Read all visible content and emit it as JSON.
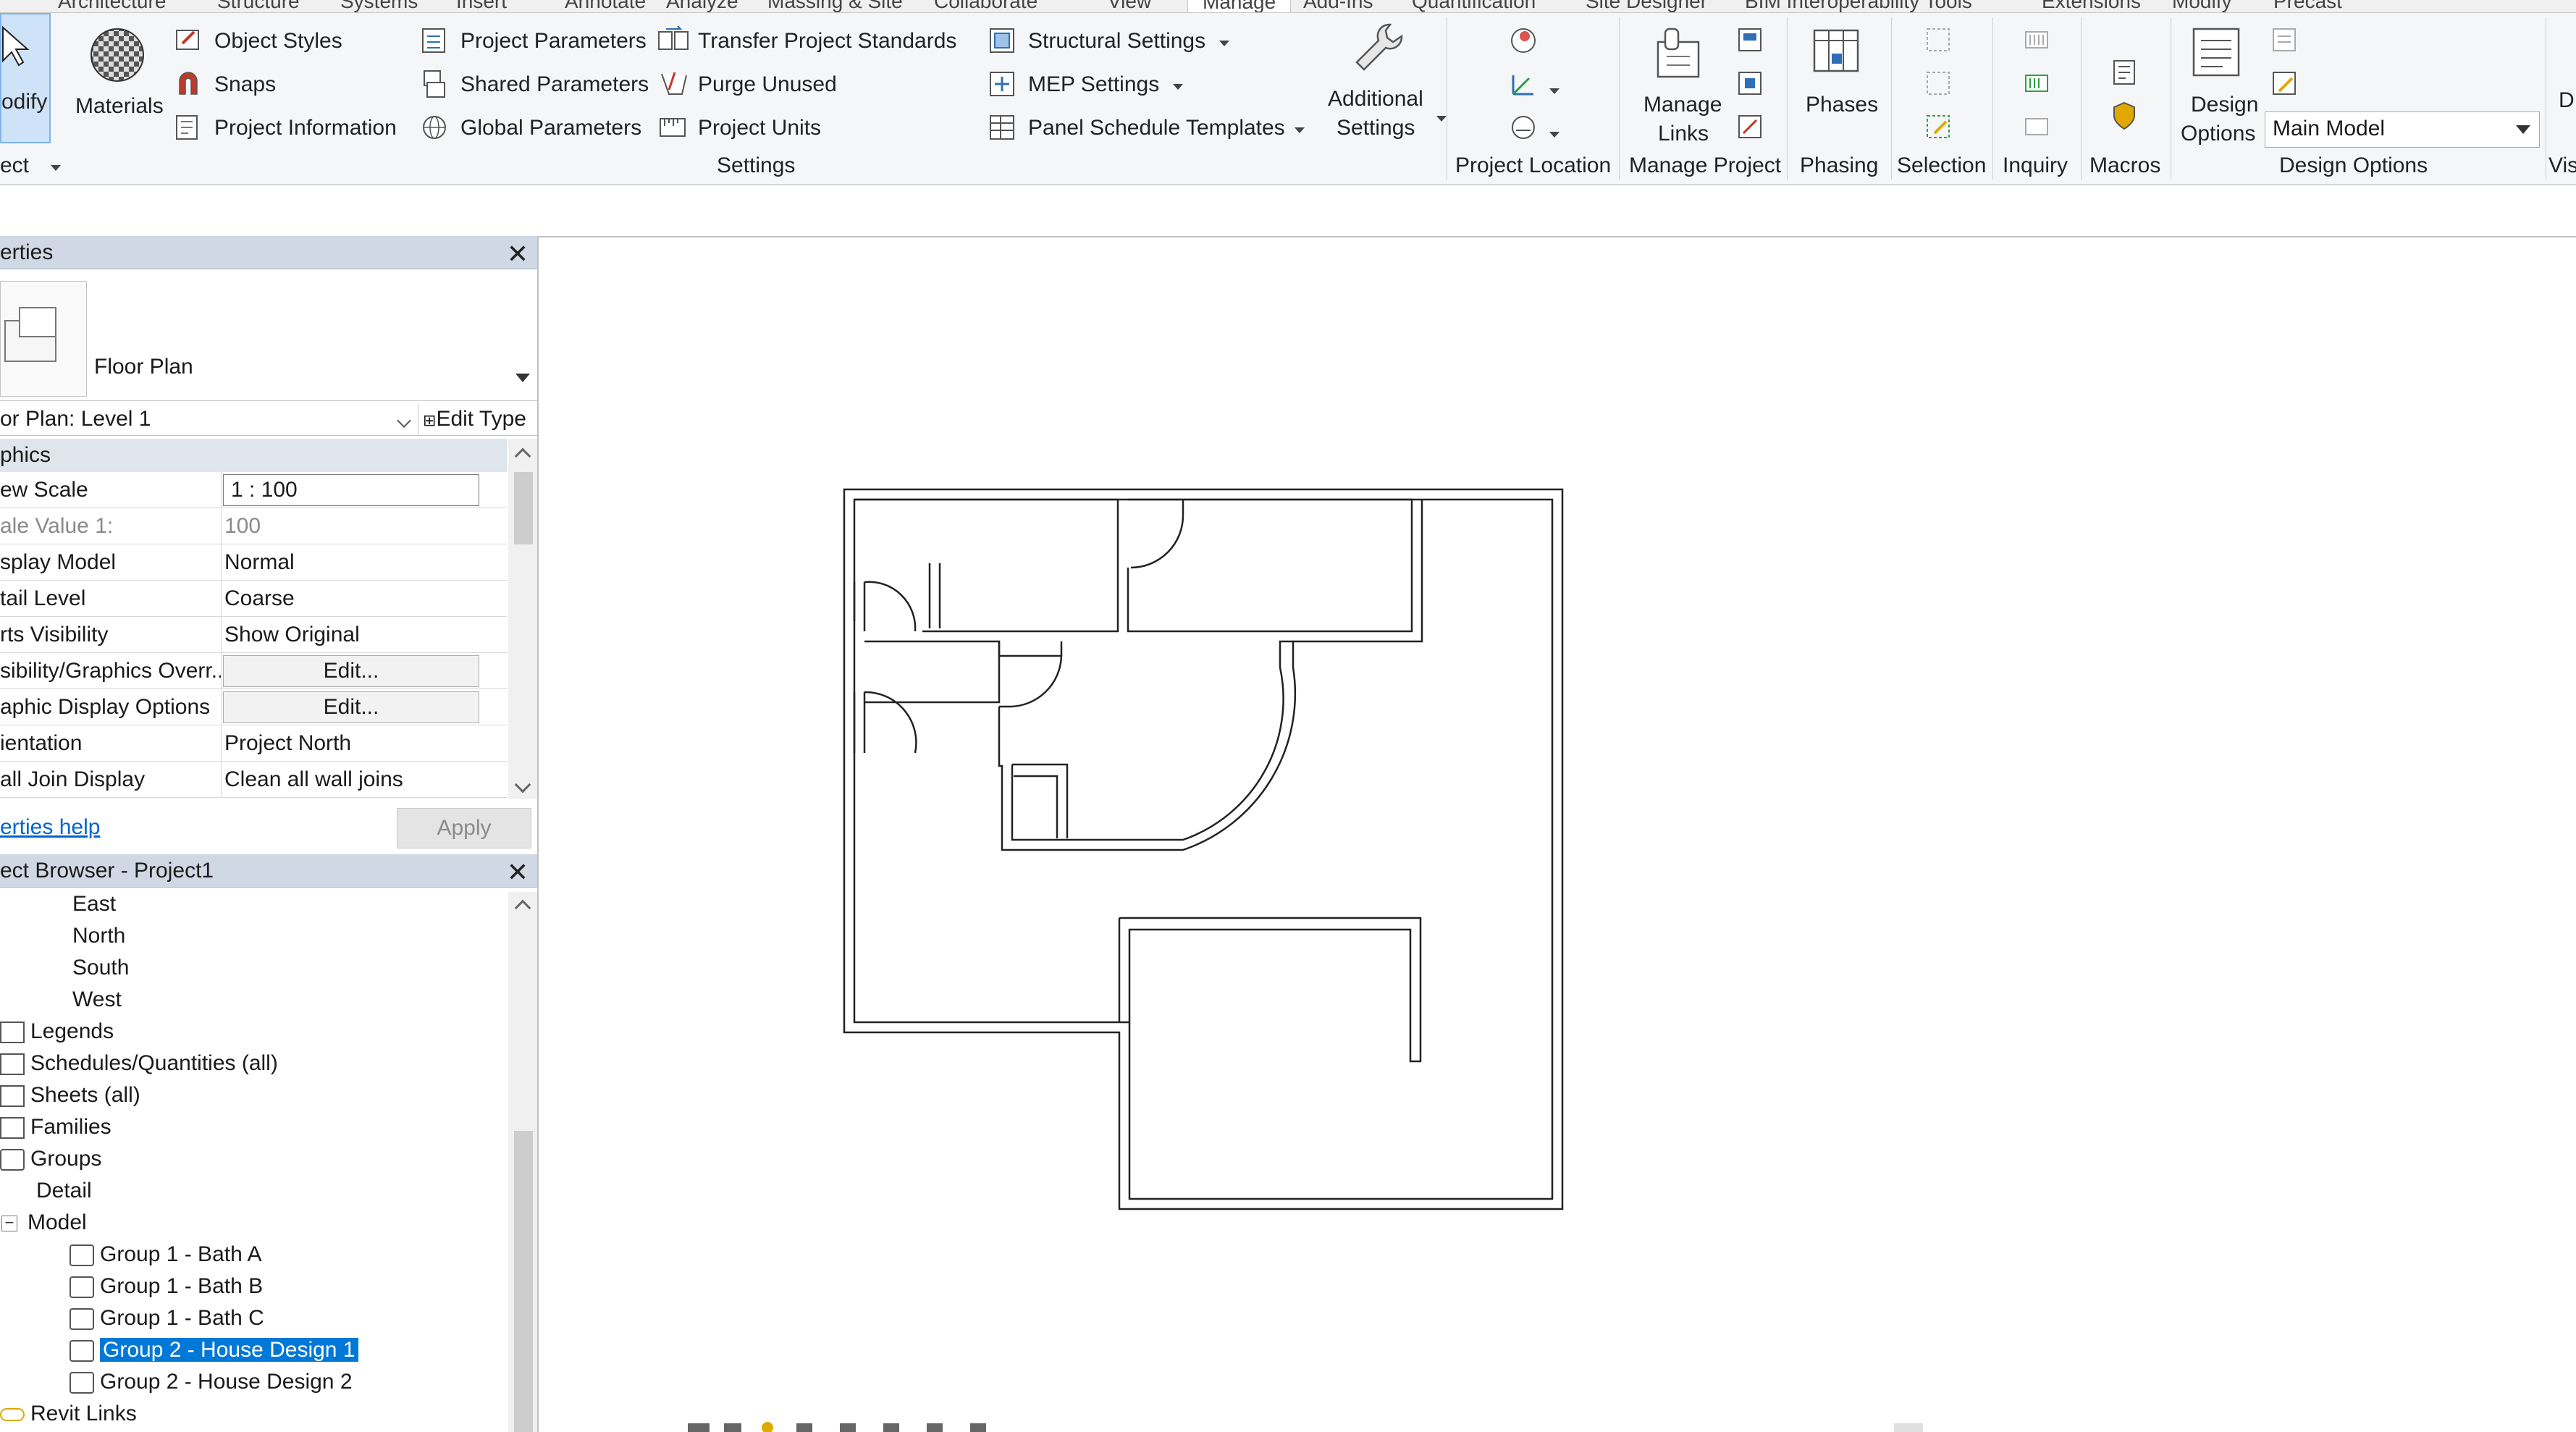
{
  "ribbon": {
    "tabs": [
      "Architecture",
      "Structure",
      "Systems",
      "Insert",
      "Annotate",
      "Analyze",
      "Massing & Site",
      "Collaborate",
      "View",
      "Manage",
      "Add-Ins",
      "Quantification",
      "Site Designer",
      "BIM Interoperability Tools",
      "Extensions",
      "Modify",
      "Precast"
    ],
    "active_tab": "Manage",
    "modify_label": "odify",
    "select_label": "ect",
    "materials_label": "Materials",
    "settings": {
      "object_styles": "Object  Styles",
      "snaps": "Snaps",
      "project_information": "Project  Information",
      "project_parameters": "Project  Parameters",
      "shared_parameters": "Shared  Parameters",
      "global_parameters": "Global  Parameters",
      "transfer_project_standards": "Transfer  Project Standards",
      "purge_unused": "Purge  Unused",
      "project_units": "Project  Units",
      "structural_settings": "Structural  Settings",
      "mep_settings": "MEP  Settings",
      "panel_schedule_templates": "Panel Schedule  Templates",
      "additional_settings_1": "Additional",
      "additional_settings_2": "Settings"
    },
    "panels": {
      "settings": "Settings",
      "project_location": "Project Location",
      "manage_project": "Manage Project",
      "phasing": "Phasing",
      "selection": "Selection",
      "inquiry": "Inquiry",
      "macros": "Macros",
      "design_options": "Design Options",
      "visual": "Vis"
    },
    "manage_links_1": "Manage",
    "manage_links_2": "Links",
    "phases": "Phases",
    "design_options_1": "Design",
    "design_options_2": "Options",
    "design_option_value": "Main Model",
    "cut_right": "D"
  },
  "properties": {
    "title": "erties",
    "type_name": "Floor Plan",
    "selector": "or Plan: Level 1",
    "edit_type": "Edit Type",
    "group": "phics",
    "rows": [
      {
        "k": "ew Scale",
        "v": "1 : 100",
        "kind": "input"
      },
      {
        "k": "ale Value    1:",
        "v": "100",
        "kind": "grey"
      },
      {
        "k": "splay Model",
        "v": "Normal",
        "kind": "text"
      },
      {
        "k": "tail Level",
        "v": "Coarse",
        "kind": "text"
      },
      {
        "k": "rts Visibility",
        "v": "Show Original",
        "kind": "text"
      },
      {
        "k": "sibility/Graphics Overr...",
        "v": "Edit...",
        "kind": "btn"
      },
      {
        "k": "aphic Display Options",
        "v": "Edit...",
        "kind": "btn"
      },
      {
        "k": "ientation",
        "v": "Project North",
        "kind": "text"
      },
      {
        "k": "all Join Display",
        "v": "Clean all wall joins",
        "kind": "text"
      }
    ],
    "help": "erties help",
    "apply": "Apply"
  },
  "browser": {
    "title": "ect Browser - Project1",
    "items": [
      {
        "label": "East",
        "level": 2,
        "icon": "none"
      },
      {
        "label": "North",
        "level": 2,
        "icon": "none"
      },
      {
        "label": "South",
        "level": 2,
        "icon": "none"
      },
      {
        "label": "West",
        "level": 2,
        "icon": "none"
      },
      {
        "label": "Legends",
        "level": 0,
        "icon": "legend"
      },
      {
        "label": "Schedules/Quantities (all)",
        "level": 0,
        "icon": "schedule"
      },
      {
        "label": "Sheets (all)",
        "level": 0,
        "icon": "sheet"
      },
      {
        "label": "Families",
        "level": 0,
        "icon": "family"
      },
      {
        "label": "Groups",
        "level": 0,
        "icon": "group"
      },
      {
        "label": "Detail",
        "level": 1,
        "icon": "none"
      },
      {
        "label": "Model",
        "level": 1,
        "icon": "none",
        "expander": "−"
      },
      {
        "label": "Group 1 - Bath A",
        "level": 2,
        "icon": "group"
      },
      {
        "label": "Group 1 - Bath B",
        "level": 2,
        "icon": "group"
      },
      {
        "label": "Group 1 - Bath C",
        "level": 2,
        "icon": "group"
      },
      {
        "label": "Group 2 - House Design 1",
        "level": 2,
        "icon": "group",
        "selected": true
      },
      {
        "label": "Group 2 - House Design 2",
        "level": 2,
        "icon": "group"
      },
      {
        "label": "Revit Links",
        "level": 0,
        "icon": "link"
      }
    ]
  },
  "colors": {
    "accent": "#0078d7",
    "panel_header": "#cfd8e4",
    "ribbon_bg": "#f5f6f7"
  }
}
